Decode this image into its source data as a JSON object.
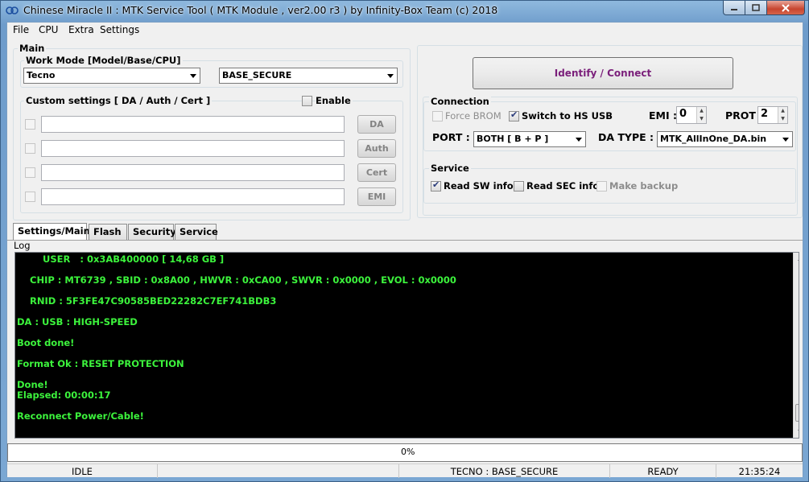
{
  "window": {
    "title": "Chinese Miracle II : MTK Service Tool ( MTK Module , ver2.00 r3  ) by Infinity-Box Team (c) 2018"
  },
  "menu": {
    "items": [
      "File",
      "CPU",
      "Extra",
      "Settings"
    ]
  },
  "main": {
    "label": "Main",
    "work_mode": {
      "label": "Work Mode [Model/Base/CPU]",
      "model": "Tecno",
      "base": "BASE_SECURE"
    },
    "custom_settings": {
      "label": "Custom settings [ DA / Auth / Cert ]",
      "enable_label": "Enable",
      "enable_checked": false,
      "rows": [
        {
          "button": "DA",
          "value": ""
        },
        {
          "button": "Auth",
          "value": ""
        },
        {
          "button": "Cert",
          "value": ""
        },
        {
          "button": "EMI",
          "value": ""
        }
      ]
    }
  },
  "identify_button": "Identify / Connect",
  "connection": {
    "label": "Connection",
    "force_brom": {
      "label": "Force BROM",
      "checked": false
    },
    "hs_usb": {
      "label": "Switch to HS USB",
      "checked": true
    },
    "emi_label": "EMI :",
    "emi_value": "0",
    "prot_label": "PROT :",
    "prot_value": "2",
    "port_label": "PORT :",
    "port_value": "BOTH [ B + P ]",
    "da_type_label": "DA TYPE :",
    "da_type_value": "MTK_AllInOne_DA.bin"
  },
  "service": {
    "label": "Service",
    "read_sw": {
      "label": "Read SW info",
      "checked": true
    },
    "read_sec": {
      "label": "Read SEC info",
      "checked": false
    },
    "make_backup": {
      "label": "Make backup",
      "checked": false
    }
  },
  "tabs": [
    "Settings/Main",
    "Flash",
    "Security",
    "Service"
  ],
  "log": {
    "label": "Log",
    "lines": [
      "        USER   : 0x3AB400000 [ 14,68 GB ]",
      "    CHIP : MT6739 , SBID : 0x8A00 , HWVR : 0xCA00 , SWVR : 0x0000 , EVOL : 0x0000",
      "    RNID : 5F3FE47C90585BED22282C7EF741BDB3",
      "DA : USB : HIGH-SPEED",
      "Boot done!",
      "Format Ok : RESET PROTECTION",
      "Done!",
      "Elapsed: 00:00:17",
      "Reconnect Power/Cable!"
    ]
  },
  "progress": {
    "text": "0%",
    "value": 0
  },
  "status": {
    "state": "IDLE",
    "model": "TECNO : BASE_SECURE",
    "ready": "READY",
    "time": "21:35:24"
  }
}
